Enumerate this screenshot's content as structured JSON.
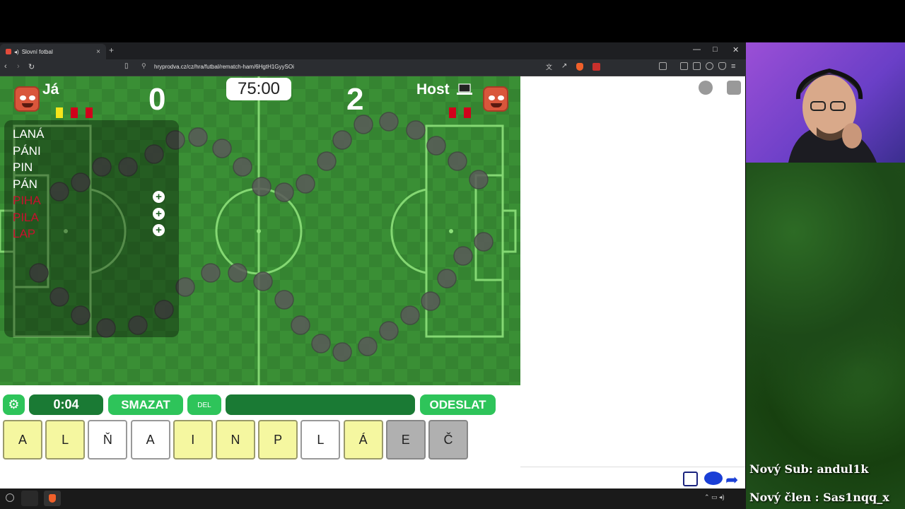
{
  "browser": {
    "tab_title": "Slovní fotbal",
    "url": "hryprodva.cz/cz/hra/futbal/rematch-ham/6HgtH1GyySOi"
  },
  "game": {
    "player_left": {
      "name": "Já",
      "score": "0"
    },
    "player_right": {
      "name": "Host",
      "score": "2"
    },
    "match_timer": "75:00",
    "words": [
      {
        "text": "LANÁ",
        "status": "ok"
      },
      {
        "text": "PÁNI",
        "status": "ok"
      },
      {
        "text": "PIN",
        "status": "ok"
      },
      {
        "text": "PÁN",
        "status": "ok"
      },
      {
        "text": "PIHA",
        "status": "bad"
      },
      {
        "text": "PILA",
        "status": "bad"
      },
      {
        "text": "LAP",
        "status": "bad"
      }
    ],
    "plus_icon": "+",
    "settings_icon": "⚙",
    "turn_timer": "0:04",
    "clear_label": "SMAZAT",
    "del_label": "DEL",
    "current_word": "",
    "submit_label": "ODESLAT",
    "letters": [
      {
        "l": "A",
        "style": "y"
      },
      {
        "l": "L",
        "style": "y"
      },
      {
        "l": "Ň",
        "style": "w"
      },
      {
        "l": "A",
        "style": "w"
      },
      {
        "l": "I",
        "style": "y"
      },
      {
        "l": "N",
        "style": "y"
      },
      {
        "l": "P",
        "style": "y"
      },
      {
        "l": "L",
        "style": "w"
      },
      {
        "l": "Á",
        "style": "y"
      },
      {
        "l": "E",
        "style": "g"
      },
      {
        "l": "Č",
        "style": "g"
      }
    ]
  },
  "overlay": {
    "new_sub": "Nový Sub: andul1k",
    "new_member": "Nový člen : Sas1nqq_x"
  },
  "colors": {
    "accent_green": "#2ec45a",
    "field_green": "#3a8f35",
    "red_card": "#d0021b",
    "yellow_card": "#f5e51b"
  }
}
